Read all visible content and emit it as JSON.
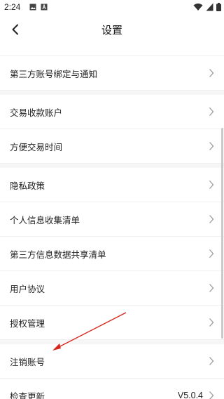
{
  "status_bar": {
    "time": "2:24"
  },
  "header": {
    "title": "设置"
  },
  "rows": {
    "cut_top": "",
    "third_party_binding": "第三方账号绑定与通知",
    "trade_account": "交易收款账户",
    "trade_time": "方便交易时间",
    "privacy_policy": "隐私政策",
    "personal_info_list": "个人信息收集清单",
    "third_party_share": "第三方信息数据共享清单",
    "user_agreement": "用户协议",
    "authorization": "授权管理",
    "cancel_account": "注销账号",
    "check_update": "检查更新",
    "version": "V5.0.4"
  },
  "colors": {
    "annotation_arrow": "#d9241c",
    "page_background": "#f6f6f6"
  }
}
